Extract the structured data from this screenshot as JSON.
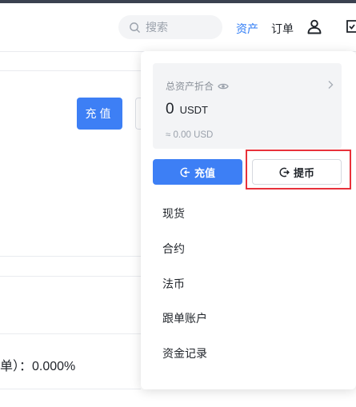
{
  "header": {
    "search_placeholder": "搜索",
    "nav_assets": "资产",
    "nav_orders": "订单"
  },
  "background": {
    "deposit_button": "充值",
    "rate_prefix": "单）：",
    "rate_value": "0.000%"
  },
  "dropdown": {
    "total_label": "总资产折合",
    "balance_value": "0",
    "balance_unit": "USDT",
    "usd_equivalent": "≈ 0.00 USD",
    "deposit_button": "充值",
    "withdraw_button": "提币",
    "menu": [
      "现货",
      "合约",
      "法币",
      "跟单账户",
      "资金记录"
    ]
  },
  "colors": {
    "accent": "#3d7ff5",
    "highlight": "#e8313a"
  },
  "icons": [
    "search-icon",
    "user-icon",
    "eye-icon",
    "chevron-right-icon",
    "deposit-icon",
    "withdraw-icon"
  ]
}
